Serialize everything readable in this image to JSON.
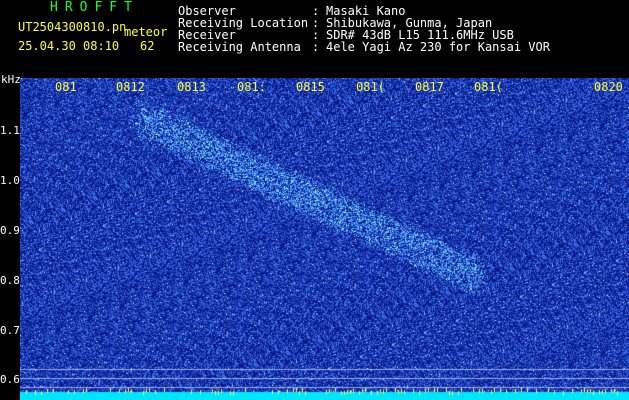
{
  "header": {
    "brand": "HROFFT",
    "filename": "UT2504300810.pn",
    "kind": "meteor",
    "datetime": "25.04.30 08:10",
    "count": "62",
    "fields": [
      {
        "label": "Observer",
        "value": "Masaki Kano"
      },
      {
        "label": "Receiving Location",
        "value": "Shibukawa, Gunma, Japan"
      },
      {
        "label": "Receiver",
        "value": "SDR# 43dB L15 111.6MHz USB"
      },
      {
        "label": "Receiving Antenna",
        "value": "4ele Yagi Az 230 for Kansai VOR"
      }
    ],
    "separator": ":"
  },
  "spectrogram": {
    "y_unit": "kHz",
    "y_ticks": [
      "1.1",
      "1.0",
      "0.9",
      "0.8",
      "0.7",
      "0.6"
    ],
    "x_ticks": [
      "081",
      "0812",
      "0813",
      "081:",
      "0815",
      "081(",
      "0817",
      "081(",
      "0820"
    ],
    "colors": {
      "background": "#0a1a8a",
      "noise": "#3a6cff",
      "trace": "#6fd8ff",
      "carrier": "#00e6ff"
    }
  }
}
